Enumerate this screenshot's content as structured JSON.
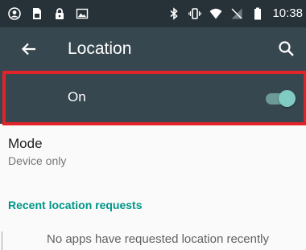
{
  "status_bar": {
    "left_icons": [
      "avatar-icon",
      "sim-card-icon",
      "lock-icon",
      "image-icon"
    ],
    "right_icons": [
      "bluetooth-icon",
      "vibrate-icon",
      "wifi-icon",
      "no-signal-icon",
      "battery-icon"
    ],
    "time": "10:38"
  },
  "toolbar": {
    "title": "Location",
    "back_icon": "arrow-left-icon",
    "search_icon": "search-icon"
  },
  "master_switch": {
    "label": "On",
    "checked": true,
    "highlight_color": "#e2232a"
  },
  "mode": {
    "title": "Mode",
    "value": "Device only"
  },
  "recent_requests": {
    "header": "Recent location requests",
    "empty_message": "No apps have requested location recently"
  },
  "colors": {
    "status_bar_bg": "#263238",
    "toolbar_bg": "#37474f",
    "accent": "#009688",
    "toggle_thumb": "#80cbc4"
  }
}
